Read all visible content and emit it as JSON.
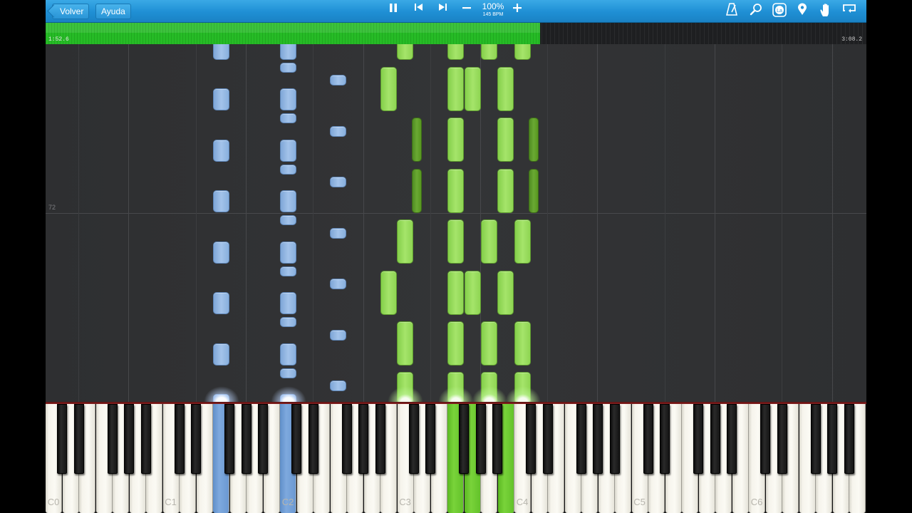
{
  "toolbar": {
    "back_label": "Volver",
    "help_label": "Ayuda",
    "speed_percent": "100%",
    "speed_bpm": "145 BPM",
    "icons": [
      "pause-icon",
      "skip-back-icon",
      "skip-forward-icon",
      "minus-icon",
      "plus-icon",
      "metronome-icon",
      "magnifier-icon",
      "note-labels-icon",
      "location-pin-icon",
      "hand-icon",
      "loop-icon"
    ],
    "note_labels_text": "La"
  },
  "progress": {
    "elapsed": "1:52.6",
    "total": "3:08.2",
    "fraction": 0.602
  },
  "roll": {
    "measure_number": "72"
  },
  "keyboard": {
    "octave_labels": [
      "C0",
      "C1",
      "C2",
      "C3",
      "C4",
      "C5",
      "C6"
    ]
  },
  "colors": {
    "left_hand": "#9bbde6",
    "right_hand": "#97dc5c",
    "toolbar": "#2a98db",
    "progress": "#26bb26"
  }
}
